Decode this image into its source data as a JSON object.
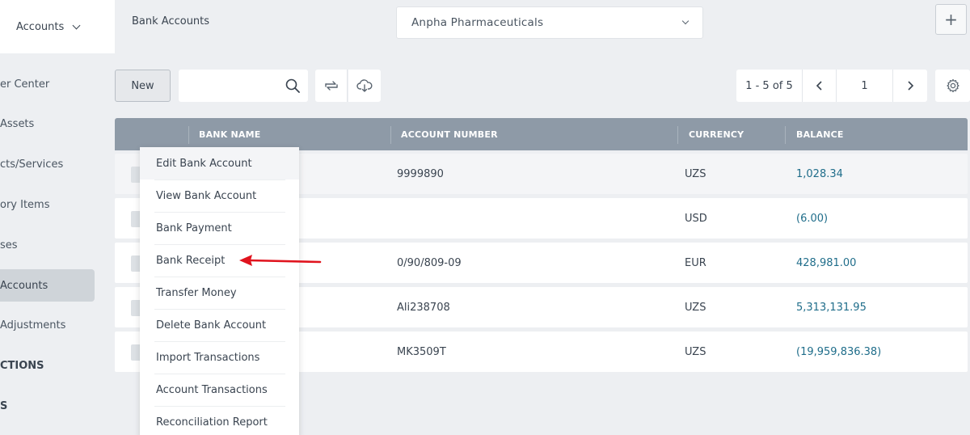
{
  "header": {
    "module_label": "Accounts",
    "breadcrumb": "Bank Accounts",
    "company": "Anpha Pharmaceuticals",
    "add_label": "+"
  },
  "sidebar": {
    "items": [
      {
        "label": "er Center"
      },
      {
        "label": "Assets"
      },
      {
        "label": "cts/Services"
      },
      {
        "label": "ory Items"
      },
      {
        "label": "ses"
      },
      {
        "label": "Accounts",
        "active": true
      },
      {
        "label": "Adjustments"
      },
      {
        "label": "CTIONS"
      },
      {
        "label": "S"
      }
    ]
  },
  "toolbar": {
    "new_label": "New",
    "search_placeholder": "",
    "pager_range": "1 - 5 of 5",
    "page_number": "1"
  },
  "table": {
    "columns": [
      "BANK NAME",
      "ACCOUNT NUMBER",
      "CURRENCY",
      "BALANCE"
    ],
    "rows": [
      {
        "account_number": "9999890",
        "currency": "UZS",
        "balance": "1,028.34"
      },
      {
        "account_number": "",
        "currency": "USD",
        "balance": "(6.00)"
      },
      {
        "account_number": "0/90/809-09",
        "currency": "EUR",
        "balance": "428,981.00"
      },
      {
        "account_number": "Ali238708",
        "currency": "UZS",
        "balance": "5,313,131.95"
      },
      {
        "account_number": "MK3509T",
        "currency": "UZS",
        "balance": "(19,959,836.38)"
      }
    ]
  },
  "menu": {
    "items": [
      "Edit Bank Account",
      "View Bank Account",
      "Bank Payment",
      "Bank Receipt",
      "Transfer Money",
      "Delete Bank Account",
      "Import Transactions",
      "Account Transactions",
      "Reconciliation Report"
    ]
  },
  "colors": {
    "table_header": "#8e9aa7",
    "balance_text": "#1f6d8a",
    "annotation_arrow": "#e0141e"
  },
  "icons": [
    "chevron-down-icon",
    "search-icon",
    "refresh-icon",
    "cloud-download-icon",
    "chevron-left-icon",
    "chevron-right-icon",
    "gear-icon",
    "red-arrow-annotation"
  ]
}
